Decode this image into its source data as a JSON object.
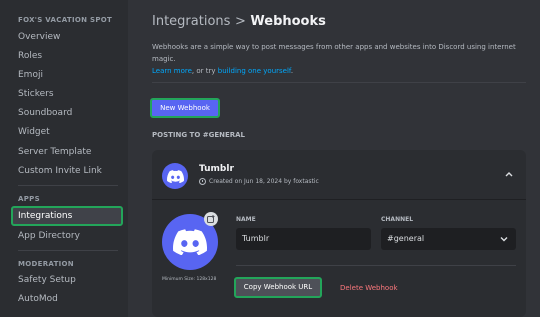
{
  "sidebar": {
    "server_name": "FOX'S VACATION SPOT",
    "items": [
      {
        "label": "Overview"
      },
      {
        "label": "Roles"
      },
      {
        "label": "Emoji"
      },
      {
        "label": "Stickers"
      },
      {
        "label": "Soundboard"
      },
      {
        "label": "Widget"
      },
      {
        "label": "Server Template"
      },
      {
        "label": "Custom Invite Link"
      }
    ],
    "apps_heading": "APPS",
    "apps_items": [
      {
        "label": "Integrations",
        "active": true
      },
      {
        "label": "App Directory"
      }
    ],
    "moderation_heading": "MODERATION",
    "moderation_items": [
      {
        "label": "Safety Setup"
      },
      {
        "label": "AutoMod"
      }
    ]
  },
  "header": {
    "breadcrumb_parent": "Integrations",
    "breadcrumb_sep": ">",
    "title": "Webhooks"
  },
  "description": {
    "text": "Webhooks are a simple way to post messages from other apps and websites into Discord using internet magic.",
    "learn_more": "Learn more",
    "middle": ", or try ",
    "build_link": "building one yourself",
    "end": "."
  },
  "new_webhook_label": "New Webhook",
  "posting_label": "POSTING TO #GENERAL",
  "webhook": {
    "name": "Tumblr",
    "created": "Created on Jun 18, 2024 by foxtastic",
    "name_label": "NAME",
    "name_value": "Tumblr",
    "channel_label": "CHANNEL",
    "channel_value": "#general",
    "min_size": "Minimum Size: 128x128",
    "copy_url_label": "Copy Webhook URL",
    "delete_label": "Delete Webhook"
  },
  "colors": {
    "blurple": "#5865f2",
    "highlight": "#23a55a",
    "danger": "#fa777c",
    "link": "#00a8fc"
  }
}
